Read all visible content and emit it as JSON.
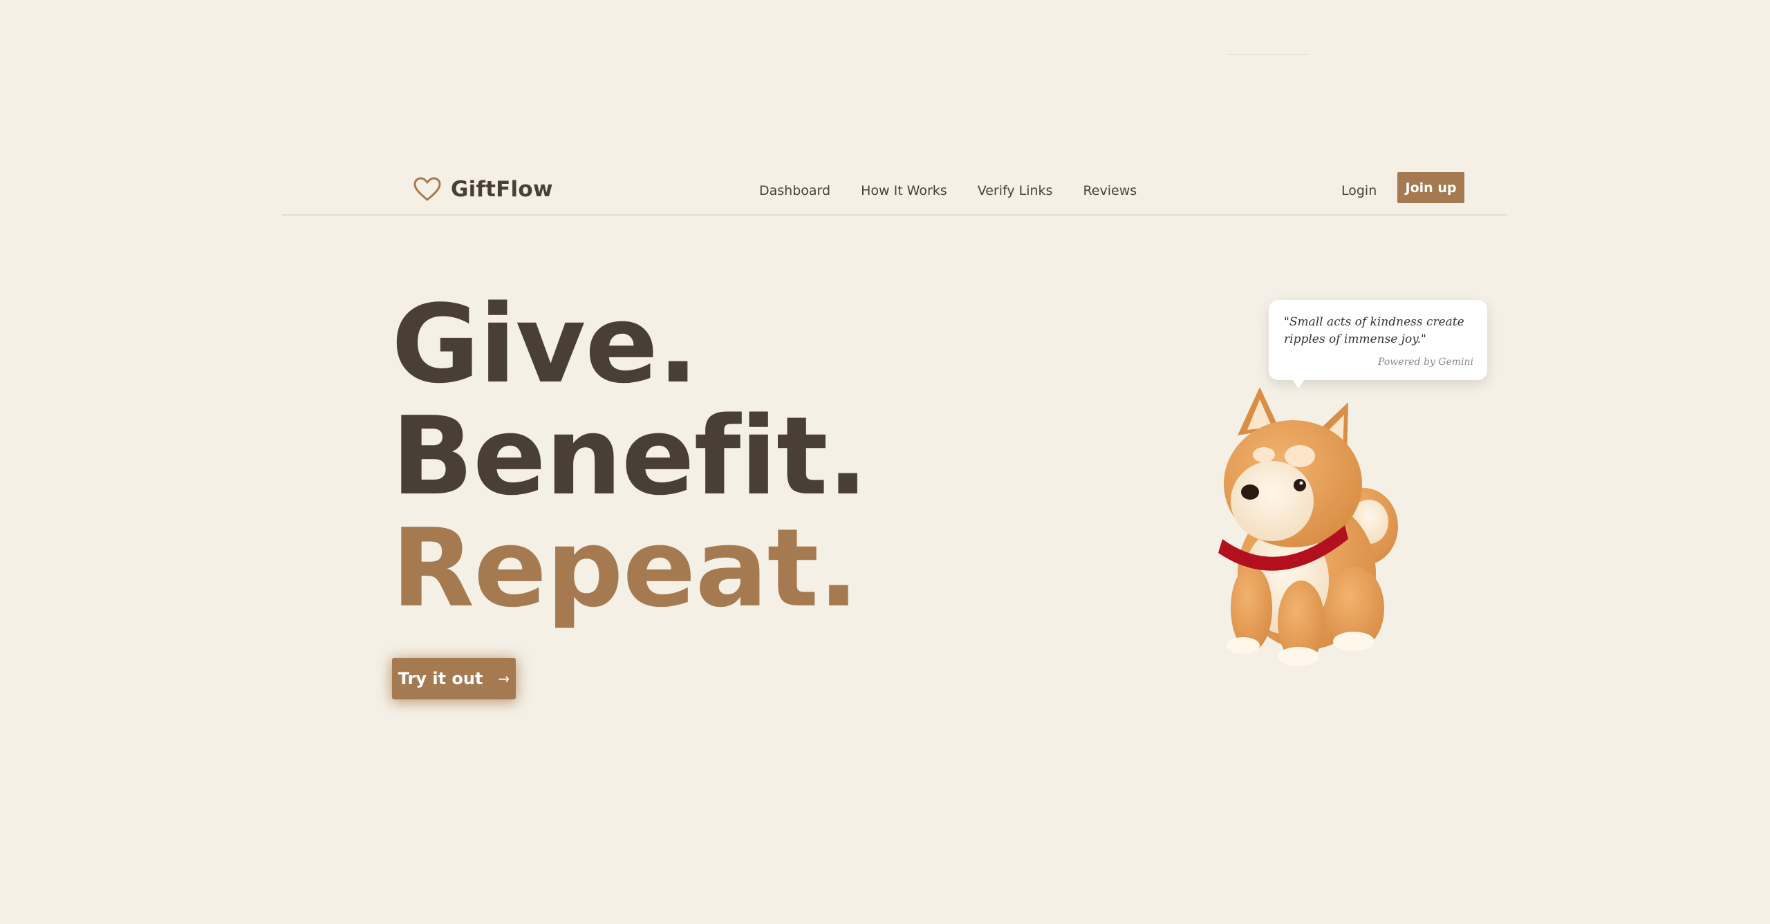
{
  "brand": {
    "name": "GiftFlow",
    "icon": "heart-outline-icon",
    "accent": "#a57a51"
  },
  "nav": {
    "links": [
      "Dashboard",
      "How It Works",
      "Verify Links",
      "Reviews"
    ],
    "login_label": "Login",
    "join_label": "Join up"
  },
  "hero": {
    "line1": "Give.",
    "line2": "Benefit.",
    "line3": "Repeat.",
    "cta_label": "Try it out",
    "cta_icon": "arrow-right-icon"
  },
  "bubble": {
    "quote": "\"Small acts of kindness create ripples of immense joy.\"",
    "powered_by": "Powered by Gemini"
  },
  "colors": {
    "background": "#f5f0e6",
    "text": "#4a3f35",
    "accent": "#a57a51"
  }
}
